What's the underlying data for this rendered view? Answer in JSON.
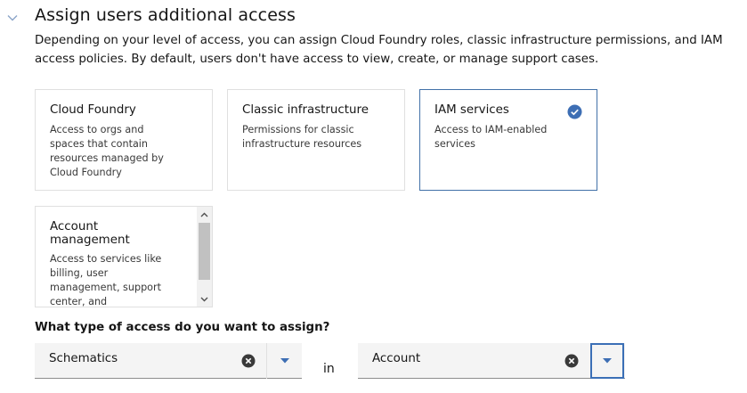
{
  "section": {
    "title": "Assign users additional access",
    "description": "Depending on your level of access, you can assign Cloud Foundry roles, classic infrastructure permissions, and IAM access policies. By default, users don't have access to view, create, or manage support cases."
  },
  "tiles": [
    {
      "title": "Cloud Foundry",
      "description": "Access to orgs and spaces that contain resources managed by Cloud Foundry",
      "selected": false
    },
    {
      "title": "Classic infrastructure",
      "description": "Permissions for classic infrastructure resources",
      "selected": false
    },
    {
      "title": "IAM services",
      "description": "Access to IAM-enabled services",
      "selected": true
    },
    {
      "title": "Account management",
      "description": "Access to services like billing, user management, support center, and",
      "selected": false
    }
  ],
  "access_question": "What type of access do you want to assign?",
  "service_select": {
    "value": "Schematics"
  },
  "in_label": "in",
  "scope_select": {
    "value": "Account"
  },
  "colors": {
    "accent": "#0f62fe",
    "check": "#3d6eb4"
  },
  "icons": [
    "chevron-down-icon",
    "checkmark-filled-icon",
    "clear-icon",
    "caret-down-icon",
    "scroll-up-icon",
    "scroll-down-icon"
  ]
}
